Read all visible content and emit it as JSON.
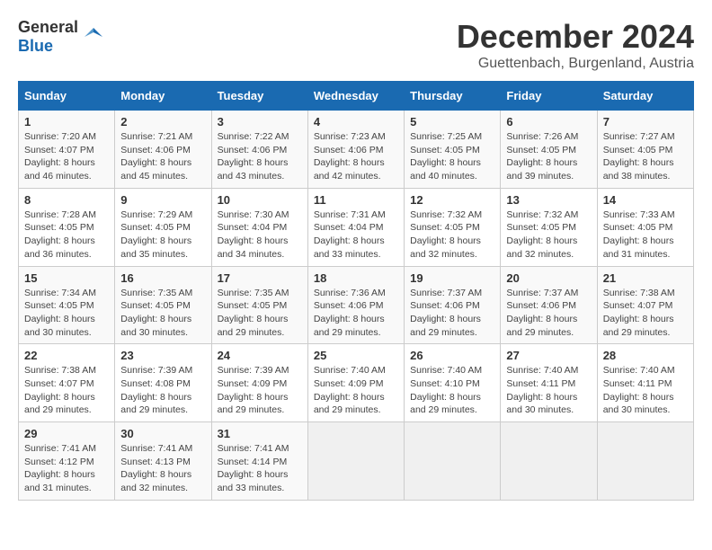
{
  "logo": {
    "general": "General",
    "blue": "Blue"
  },
  "title": {
    "month": "December 2024",
    "location": "Guettenbach, Burgenland, Austria"
  },
  "weekdays": [
    "Sunday",
    "Monday",
    "Tuesday",
    "Wednesday",
    "Thursday",
    "Friday",
    "Saturday"
  ],
  "weeks": [
    [
      {
        "day": "1",
        "info": "Sunrise: 7:20 AM\nSunset: 4:07 PM\nDaylight: 8 hours\nand 46 minutes."
      },
      {
        "day": "2",
        "info": "Sunrise: 7:21 AM\nSunset: 4:06 PM\nDaylight: 8 hours\nand 45 minutes."
      },
      {
        "day": "3",
        "info": "Sunrise: 7:22 AM\nSunset: 4:06 PM\nDaylight: 8 hours\nand 43 minutes."
      },
      {
        "day": "4",
        "info": "Sunrise: 7:23 AM\nSunset: 4:06 PM\nDaylight: 8 hours\nand 42 minutes."
      },
      {
        "day": "5",
        "info": "Sunrise: 7:25 AM\nSunset: 4:05 PM\nDaylight: 8 hours\nand 40 minutes."
      },
      {
        "day": "6",
        "info": "Sunrise: 7:26 AM\nSunset: 4:05 PM\nDaylight: 8 hours\nand 39 minutes."
      },
      {
        "day": "7",
        "info": "Sunrise: 7:27 AM\nSunset: 4:05 PM\nDaylight: 8 hours\nand 38 minutes."
      }
    ],
    [
      {
        "day": "8",
        "info": "Sunrise: 7:28 AM\nSunset: 4:05 PM\nDaylight: 8 hours\nand 36 minutes."
      },
      {
        "day": "9",
        "info": "Sunrise: 7:29 AM\nSunset: 4:05 PM\nDaylight: 8 hours\nand 35 minutes."
      },
      {
        "day": "10",
        "info": "Sunrise: 7:30 AM\nSunset: 4:04 PM\nDaylight: 8 hours\nand 34 minutes."
      },
      {
        "day": "11",
        "info": "Sunrise: 7:31 AM\nSunset: 4:04 PM\nDaylight: 8 hours\nand 33 minutes."
      },
      {
        "day": "12",
        "info": "Sunrise: 7:32 AM\nSunset: 4:05 PM\nDaylight: 8 hours\nand 32 minutes."
      },
      {
        "day": "13",
        "info": "Sunrise: 7:32 AM\nSunset: 4:05 PM\nDaylight: 8 hours\nand 32 minutes."
      },
      {
        "day": "14",
        "info": "Sunrise: 7:33 AM\nSunset: 4:05 PM\nDaylight: 8 hours\nand 31 minutes."
      }
    ],
    [
      {
        "day": "15",
        "info": "Sunrise: 7:34 AM\nSunset: 4:05 PM\nDaylight: 8 hours\nand 30 minutes."
      },
      {
        "day": "16",
        "info": "Sunrise: 7:35 AM\nSunset: 4:05 PM\nDaylight: 8 hours\nand 30 minutes."
      },
      {
        "day": "17",
        "info": "Sunrise: 7:35 AM\nSunset: 4:05 PM\nDaylight: 8 hours\nand 29 minutes."
      },
      {
        "day": "18",
        "info": "Sunrise: 7:36 AM\nSunset: 4:06 PM\nDaylight: 8 hours\nand 29 minutes."
      },
      {
        "day": "19",
        "info": "Sunrise: 7:37 AM\nSunset: 4:06 PM\nDaylight: 8 hours\nand 29 minutes."
      },
      {
        "day": "20",
        "info": "Sunrise: 7:37 AM\nSunset: 4:06 PM\nDaylight: 8 hours\nand 29 minutes."
      },
      {
        "day": "21",
        "info": "Sunrise: 7:38 AM\nSunset: 4:07 PM\nDaylight: 8 hours\nand 29 minutes."
      }
    ],
    [
      {
        "day": "22",
        "info": "Sunrise: 7:38 AM\nSunset: 4:07 PM\nDaylight: 8 hours\nand 29 minutes."
      },
      {
        "day": "23",
        "info": "Sunrise: 7:39 AM\nSunset: 4:08 PM\nDaylight: 8 hours\nand 29 minutes."
      },
      {
        "day": "24",
        "info": "Sunrise: 7:39 AM\nSunset: 4:09 PM\nDaylight: 8 hours\nand 29 minutes."
      },
      {
        "day": "25",
        "info": "Sunrise: 7:40 AM\nSunset: 4:09 PM\nDaylight: 8 hours\nand 29 minutes."
      },
      {
        "day": "26",
        "info": "Sunrise: 7:40 AM\nSunset: 4:10 PM\nDaylight: 8 hours\nand 29 minutes."
      },
      {
        "day": "27",
        "info": "Sunrise: 7:40 AM\nSunset: 4:11 PM\nDaylight: 8 hours\nand 30 minutes."
      },
      {
        "day": "28",
        "info": "Sunrise: 7:40 AM\nSunset: 4:11 PM\nDaylight: 8 hours\nand 30 minutes."
      }
    ],
    [
      {
        "day": "29",
        "info": "Sunrise: 7:41 AM\nSunset: 4:12 PM\nDaylight: 8 hours\nand 31 minutes."
      },
      {
        "day": "30",
        "info": "Sunrise: 7:41 AM\nSunset: 4:13 PM\nDaylight: 8 hours\nand 32 minutes."
      },
      {
        "day": "31",
        "info": "Sunrise: 7:41 AM\nSunset: 4:14 PM\nDaylight: 8 hours\nand 33 minutes."
      },
      {
        "day": "",
        "info": ""
      },
      {
        "day": "",
        "info": ""
      },
      {
        "day": "",
        "info": ""
      },
      {
        "day": "",
        "info": ""
      }
    ]
  ]
}
